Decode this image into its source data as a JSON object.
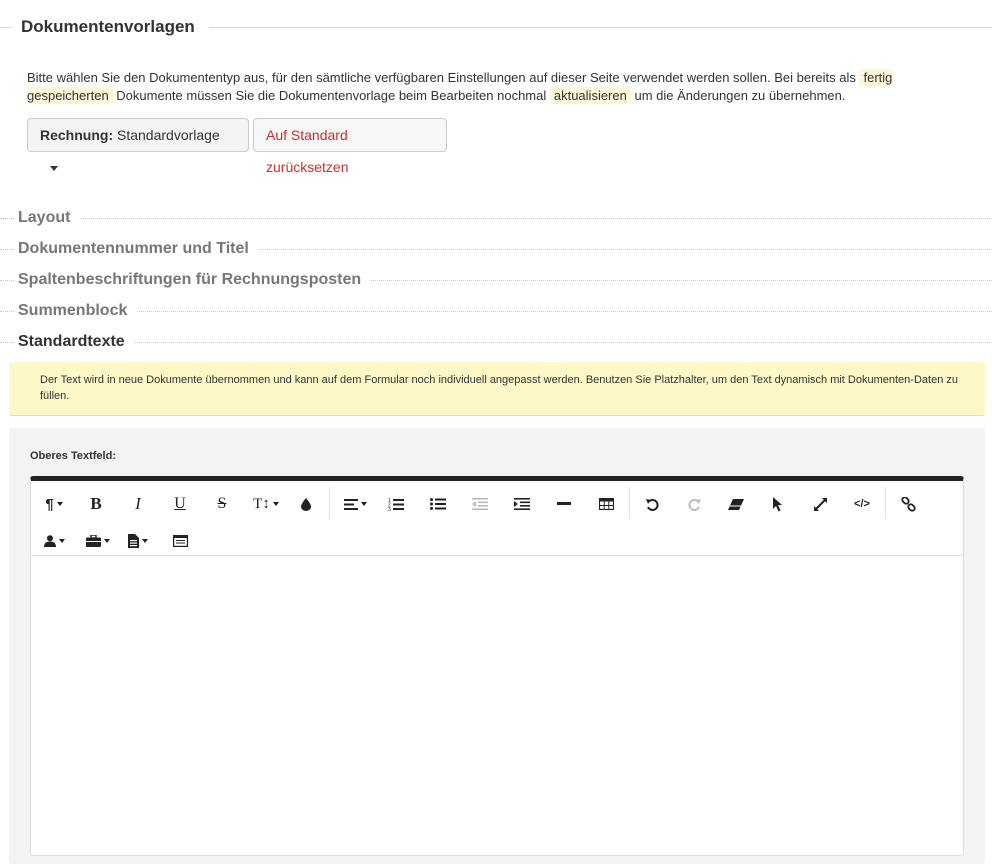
{
  "section": {
    "title": "Dokumentenvorlagen"
  },
  "intro": {
    "part1": "Bitte wählen Sie den Dokumententyp aus, für den sämtliche verfügbaren Einstellungen auf dieser Seite verwendet werden sollen. Bei bereits als ",
    "highlight1": "fertig gespeicherten",
    "part2": " Dokumente müssen Sie die Dokumentenvorlage beim Bearbeiten nochmal ",
    "highlight2": "aktualisieren",
    "part3": " um die Änderungen zu übernehmen."
  },
  "doc_type_select": {
    "label": "Rechnung:",
    "value": "Standardvorlage"
  },
  "reset_button": {
    "label": "Auf Standard zurücksetzen"
  },
  "accordion": [
    {
      "label": "Layout"
    },
    {
      "label": "Dokumentennummer und Titel"
    },
    {
      "label": "Spaltenbeschriftungen für Rechnungsposten"
    },
    {
      "label": "Summenblock"
    },
    {
      "label": "Standardtexte"
    }
  ],
  "note": "Der Text wird in neue Dokumente übernommen und kann auf dem Formular noch individuell angepasst werden. Benutzen Sie Platzhalter, um den Text dynamisch mit Dokumenten-Daten zu füllen.",
  "editor": {
    "field_label": "Oberes Textfeld:",
    "toolbar_row1": [
      "paragraph-style-icon",
      "bold-icon",
      "italic-icon",
      "underline-icon",
      "strikethrough-icon",
      "font-size-icon",
      "color-drop-icon",
      "align-icon",
      "ordered-list-icon",
      "unordered-list-icon",
      "outdent-icon",
      "indent-icon",
      "horizontal-rule-icon",
      "table-icon",
      "undo-icon",
      "redo-icon",
      "eraser-icon",
      "cursor-icon",
      "fullscreen-icon",
      "code-view-icon",
      "link-icon"
    ],
    "toolbar_row2": [
      "contact-placeholder-icon",
      "company-placeholder-icon",
      "document-placeholder-icon",
      "text-block-icon"
    ],
    "content": ""
  }
}
